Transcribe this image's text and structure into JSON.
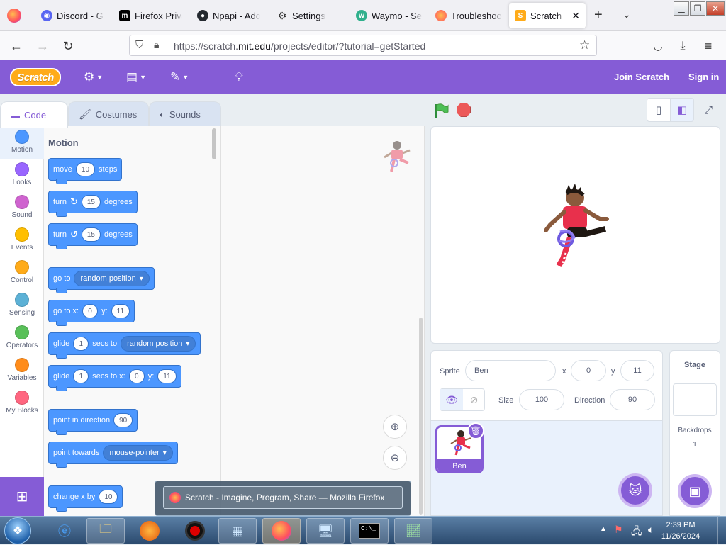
{
  "browser": {
    "tabs": [
      {
        "title": "Discord - Group",
        "icon": "discord-icon",
        "color": "#5865f2"
      },
      {
        "title": "Firefox Privacy",
        "icon": "mozilla-icon",
        "color": "#000000"
      },
      {
        "title": "Npapi - Adobe",
        "icon": "github-icon",
        "color": "#24292f"
      },
      {
        "title": "Settings",
        "icon": "gear-icon",
        "color": "#333333"
      },
      {
        "title": "Waymo - Self",
        "icon": "waymo-icon",
        "color": "#30b08c"
      },
      {
        "title": "Troubleshoot",
        "icon": "firefox-icon",
        "color": "#ff7139"
      },
      {
        "title": "Scratch - I",
        "icon": "scratch-icon",
        "color": "#ffab19"
      }
    ],
    "url_prefix": "https://scratch.",
    "url_domain": "mit.edu",
    "url_path": "/projects/editor/?tutorial=getStarted"
  },
  "menu": {
    "logo_text": "Scratch",
    "join": "Join Scratch",
    "signin": "Sign in"
  },
  "editor_tabs": {
    "code": "Code",
    "costumes": "Costumes",
    "sounds": "Sounds"
  },
  "categories": [
    {
      "label": "Motion",
      "color": "#4c97ff"
    },
    {
      "label": "Looks",
      "color": "#9966ff"
    },
    {
      "label": "Sound",
      "color": "#cf63cf"
    },
    {
      "label": "Events",
      "color": "#ffbf00"
    },
    {
      "label": "Control",
      "color": "#ffab19"
    },
    {
      "label": "Sensing",
      "color": "#5cb1d6"
    },
    {
      "label": "Operators",
      "color": "#59c059"
    },
    {
      "label": "Variables",
      "color": "#ff8c1a"
    },
    {
      "label": "My Blocks",
      "color": "#ff6680"
    }
  ],
  "palette": {
    "title": "Motion",
    "move": {
      "a": "move",
      "n": "10",
      "b": "steps"
    },
    "turn_right": {
      "a": "turn",
      "n": "15",
      "b": "degrees"
    },
    "turn_left": {
      "a": "turn",
      "n": "15",
      "b": "degrees"
    },
    "goto": {
      "a": "go to",
      "d": "random position"
    },
    "goto_xy": {
      "a": "go to x:",
      "x": "0",
      "b": "y:",
      "y": "11"
    },
    "glide": {
      "a": "glide",
      "n": "1",
      "b": "secs to",
      "d": "random position"
    },
    "glide_xy": {
      "a": "glide",
      "n": "1",
      "b": "secs to x:",
      "x": "0",
      "c": "y:",
      "y": "11"
    },
    "point_dir": {
      "a": "point in direction",
      "n": "90"
    },
    "point_towards": {
      "a": "point towards",
      "d": "mouse-pointer"
    },
    "change_x": {
      "a": "change x by",
      "n": "10"
    }
  },
  "sprite": {
    "sprite_label": "Sprite",
    "name": "Ben",
    "x_label": "x",
    "x": "0",
    "y_label": "y",
    "y": "11",
    "size_label": "Size",
    "size": "100",
    "direction_label": "Direction",
    "direction": "90",
    "thumb_label": "Ben"
  },
  "stage_panel": {
    "title": "Stage",
    "backdrops_label": "Backdrops",
    "backdrops_count": "1"
  },
  "taskbar": {
    "tooltip": "Scratch - Imagine, Program, Share — Mozilla Firefox",
    "time": "2:39 PM",
    "date": "11/26/2024"
  }
}
